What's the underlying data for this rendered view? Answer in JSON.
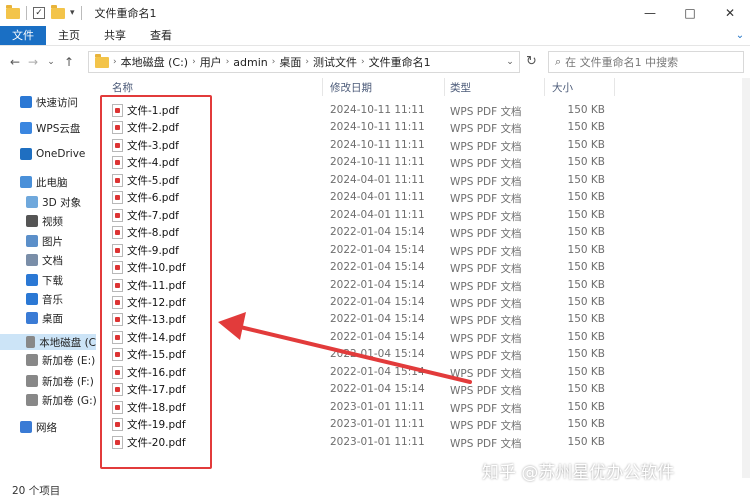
{
  "window": {
    "title": "文件重命名1",
    "controls": [
      "—",
      "□",
      "✕"
    ]
  },
  "ribbon": {
    "tabs": [
      "文件",
      "主页",
      "共享",
      "查看"
    ],
    "expand": "⌄"
  },
  "nav": {
    "back": "←",
    "forward": "→",
    "recent": "⌄",
    "up": "↑",
    "refresh": "↻"
  },
  "address": {
    "crumbs": [
      "本地磁盘 (C:)",
      "用户",
      "admin",
      "桌面",
      "测试文件",
      "文件重命名1"
    ],
    "separator": "›",
    "dropdown": "⌄"
  },
  "search": {
    "placeholder": "在 文件重命名1 中搜索"
  },
  "sidebar": {
    "items": [
      {
        "label": "快速访问",
        "icon": "star-icon",
        "color": "#2b78d4"
      },
      {
        "label": "WPS云盘",
        "icon": "cloud-icon",
        "color": "#3a86e0"
      },
      {
        "label": "OneDrive",
        "icon": "onedrive-icon",
        "color": "#1f6fc1"
      },
      {
        "label": "此电脑",
        "icon": "pc-icon",
        "color": "#4a90d9"
      },
      {
        "label": "3D 对象",
        "icon": "3d-objects-icon",
        "color": "#6fa8dc"
      },
      {
        "label": "视频",
        "icon": "video-icon",
        "color": "#555555"
      },
      {
        "label": "图片",
        "icon": "picture-icon",
        "color": "#5b8fc9"
      },
      {
        "label": "文档",
        "icon": "document-icon",
        "color": "#7a8ea8"
      },
      {
        "label": "下载",
        "icon": "download-icon",
        "color": "#2b78d4"
      },
      {
        "label": "音乐",
        "icon": "music-icon",
        "color": "#2b78d4"
      },
      {
        "label": "桌面",
        "icon": "desktop-icon",
        "color": "#3a7bd5"
      },
      {
        "label": "本地磁盘 (C",
        "icon": "drive-icon",
        "color": "#888888"
      },
      {
        "label": "新加卷 (E:)",
        "icon": "drive-icon",
        "color": "#888888"
      },
      {
        "label": "新加卷 (F:)",
        "icon": "drive-icon",
        "color": "#888888"
      },
      {
        "label": "新加卷 (G:)",
        "icon": "drive-icon",
        "color": "#888888"
      },
      {
        "label": "网络",
        "icon": "network-icon",
        "color": "#3a7bd5"
      }
    ],
    "selected_index": 11
  },
  "columns": {
    "name": "名称",
    "date": "修改日期",
    "type": "类型",
    "size": "大小"
  },
  "files": [
    {
      "name": "文件-1.pdf",
      "date": "2024-10-11 11:11",
      "type": "WPS PDF 文档",
      "size": "150 KB"
    },
    {
      "name": "文件-2.pdf",
      "date": "2024-10-11 11:11",
      "type": "WPS PDF 文档",
      "size": "150 KB"
    },
    {
      "name": "文件-3.pdf",
      "date": "2024-10-11 11:11",
      "type": "WPS PDF 文档",
      "size": "150 KB"
    },
    {
      "name": "文件-4.pdf",
      "date": "2024-10-11 11:11",
      "type": "WPS PDF 文档",
      "size": "150 KB"
    },
    {
      "name": "文件-5.pdf",
      "date": "2024-04-01 11:11",
      "type": "WPS PDF 文档",
      "size": "150 KB"
    },
    {
      "name": "文件-6.pdf",
      "date": "2024-04-01 11:11",
      "type": "WPS PDF 文档",
      "size": "150 KB"
    },
    {
      "name": "文件-7.pdf",
      "date": "2024-04-01 11:11",
      "type": "WPS PDF 文档",
      "size": "150 KB"
    },
    {
      "name": "文件-8.pdf",
      "date": "2022-01-04 15:14",
      "type": "WPS PDF 文档",
      "size": "150 KB"
    },
    {
      "name": "文件-9.pdf",
      "date": "2022-01-04 15:14",
      "type": "WPS PDF 文档",
      "size": "150 KB"
    },
    {
      "name": "文件-10.pdf",
      "date": "2022-01-04 15:14",
      "type": "WPS PDF 文档",
      "size": "150 KB"
    },
    {
      "name": "文件-11.pdf",
      "date": "2022-01-04 15:14",
      "type": "WPS PDF 文档",
      "size": "150 KB"
    },
    {
      "name": "文件-12.pdf",
      "date": "2022-01-04 15:14",
      "type": "WPS PDF 文档",
      "size": "150 KB"
    },
    {
      "name": "文件-13.pdf",
      "date": "2022-01-04 15:14",
      "type": "WPS PDF 文档",
      "size": "150 KB"
    },
    {
      "name": "文件-14.pdf",
      "date": "2022-01-04 15:14",
      "type": "WPS PDF 文档",
      "size": "150 KB"
    },
    {
      "name": "文件-15.pdf",
      "date": "2022-01-04 15:14",
      "type": "WPS PDF 文档",
      "size": "150 KB"
    },
    {
      "name": "文件-16.pdf",
      "date": "2022-01-04 15:14",
      "type": "WPS PDF 文档",
      "size": "150 KB"
    },
    {
      "name": "文件-17.pdf",
      "date": "2022-01-04 15:14",
      "type": "WPS PDF 文档",
      "size": "150 KB"
    },
    {
      "name": "文件-18.pdf",
      "date": "2023-01-01 11:11",
      "type": "WPS PDF 文档",
      "size": "150 KB"
    },
    {
      "name": "文件-19.pdf",
      "date": "2023-01-01 11:11",
      "type": "WPS PDF 文档",
      "size": "150 KB"
    },
    {
      "name": "文件-20.pdf",
      "date": "2023-01-01 11:11",
      "type": "WPS PDF 文档",
      "size": "150 KB"
    }
  ],
  "status": {
    "count": "20 个项目"
  },
  "watermark": "知乎 @苏州星优办公软件",
  "colors": {
    "accent": "#1a6fc4",
    "selection": "#cce4f7",
    "annotation": "#e23b3b"
  }
}
